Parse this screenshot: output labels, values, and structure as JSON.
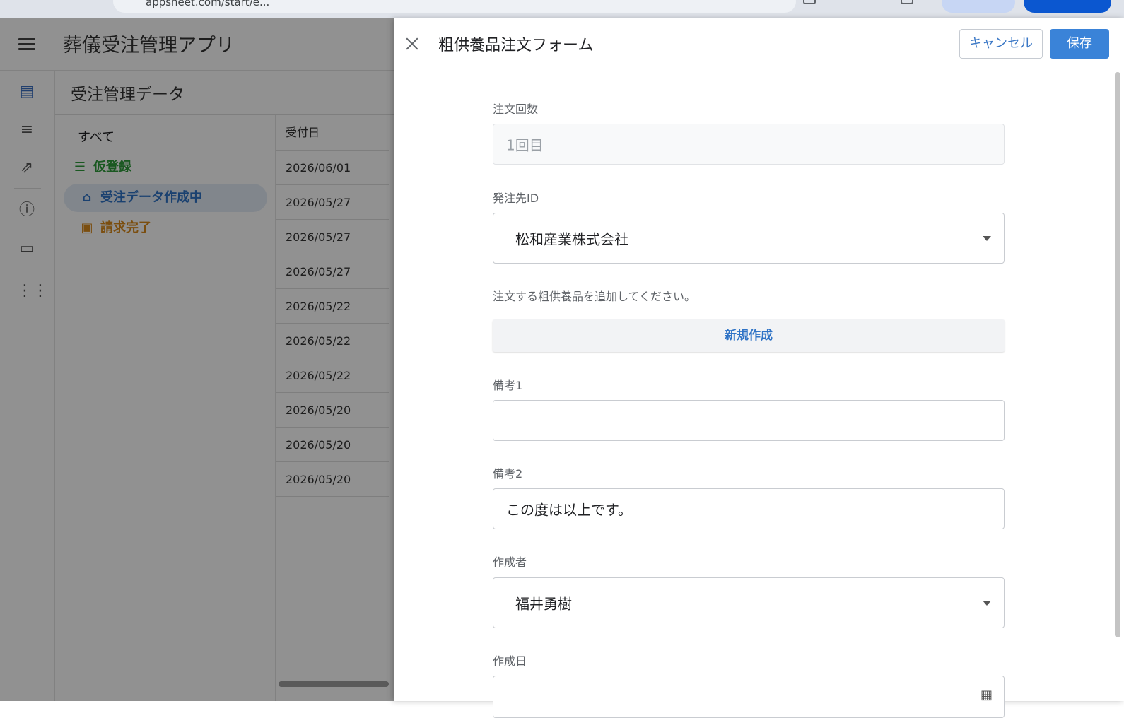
{
  "browser": {
    "url_fragment": "appsheet.com/start/e..."
  },
  "app": {
    "title": "葬儀受注管理アプリ",
    "view_title": "受注管理データ",
    "rail_icons": [
      "list-view-icon",
      "menu-lines-icon",
      "external-link-icon",
      "info-icon",
      "feedback-icon",
      "apps-grid-icon"
    ],
    "groups": [
      {
        "label": "すべて",
        "color": "#202124",
        "icon": ""
      },
      {
        "label": "仮登録",
        "color": "#2e9b3a",
        "icon": "☰"
      },
      {
        "label": "受注データ作成中",
        "color": "#2f73c6",
        "icon": "⌂"
      },
      {
        "label": "請求完了",
        "color": "#d98a1c",
        "icon": "▣"
      }
    ],
    "table": {
      "header": "受付日",
      "rows": [
        "2026/06/01",
        "2026/05/27",
        "2026/05/27",
        "2026/05/27",
        "2026/05/22",
        "2026/05/22",
        "2026/05/22",
        "2026/05/20",
        "2026/05/20",
        "2026/05/20"
      ]
    }
  },
  "form": {
    "title": "粗供養品注文フォーム",
    "cancel_label": "キャンセル",
    "save_label": "保存",
    "fields": {
      "order_count": {
        "label": "注文回数",
        "value": "1回目"
      },
      "supplier": {
        "label": "発注先ID",
        "value": "松和産業株式会社"
      },
      "items_hint": "注文する粗供養品を追加してください。",
      "new_button": "新規作成",
      "note1": {
        "label": "備考1",
        "value": ""
      },
      "note2": {
        "label": "備考2",
        "value": "この度は以上です。"
      },
      "creator": {
        "label": "作成者",
        "value": "福井勇樹"
      },
      "created_date": {
        "label": "作成日",
        "value": ""
      }
    }
  },
  "colors": {
    "accent": "#3a83d8",
    "link": "#2f73c6"
  }
}
